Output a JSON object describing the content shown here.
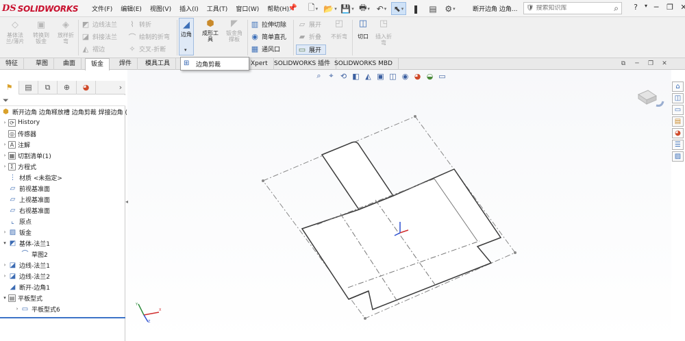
{
  "app": {
    "logo_ds": "DS",
    "logo_name": "SOLIDWORKS",
    "document_title": "断开边角 边角..."
  },
  "menu": [
    {
      "label": "文件(F)"
    },
    {
      "label": "编辑(E)"
    },
    {
      "label": "视图(V)"
    },
    {
      "label": "插入(I)"
    },
    {
      "label": "工具(T)"
    },
    {
      "label": "窗口(W)"
    },
    {
      "label": "帮助(H)"
    }
  ],
  "search": {
    "placeholder": "搜索知识库"
  },
  "ribbon": {
    "left_group": [
      {
        "label1": "基体法",
        "label2": "兰/薄片"
      },
      {
        "label1": "转换到",
        "label2": "钣金"
      },
      {
        "label1": "放样折",
        "label2": "弯"
      }
    ],
    "mid_small": [
      {
        "label": "边线法兰"
      },
      {
        "label": "斜接法兰"
      },
      {
        "label": "褶边"
      }
    ],
    "mid_small2": [
      {
        "label": "转折"
      },
      {
        "label": "绘制的折弯"
      },
      {
        "label": "交叉-折断"
      }
    ],
    "corner": {
      "label": "边角"
    },
    "forming": {
      "label1": "成形工",
      "label2": "具"
    },
    "weld_corner": {
      "label1": "钣金角",
      "label2": "撑板"
    },
    "cut_group": [
      {
        "label": "拉伸切除"
      },
      {
        "label": "简单直孔"
      },
      {
        "label": "通风口"
      }
    ],
    "unfold_group": [
      {
        "label": "展开"
      },
      {
        "label": "折叠"
      },
      {
        "label": "展开"
      }
    ],
    "no_bend": {
      "label1": "不折弯",
      "label2": ""
    },
    "cutoff": {
      "label": "切口"
    },
    "insert_bend": {
      "label1": "插入折",
      "label2": "弯"
    }
  },
  "tabs": [
    {
      "label": "特征"
    },
    {
      "label": "草图"
    },
    {
      "label": "曲面"
    },
    {
      "label": "钣金"
    },
    {
      "label": "焊件"
    },
    {
      "label": "模具工具"
    },
    {
      "label": "Xpert"
    },
    {
      "label": "SOLIDWORKS 插件"
    },
    {
      "label": "SOLIDWORKS MBD"
    }
  ],
  "dropdown": {
    "item": "边角剪裁"
  },
  "tree": {
    "root": "断开边角 边角释放槽 边角剪裁 焊接边角 (",
    "items": [
      {
        "label": "History",
        "icon": "history-icon",
        "expand": true
      },
      {
        "label": "传感器",
        "icon": "sensor-icon",
        "expand": false
      },
      {
        "label": "注解",
        "icon": "annotation-icon",
        "expand": true
      },
      {
        "label": "切割清单(1)",
        "icon": "cutlist-icon",
        "expand": true
      },
      {
        "label": "方程式",
        "icon": "equation-icon",
        "expand": true
      },
      {
        "label": "材质 <未指定>",
        "icon": "material-icon",
        "expand": false
      },
      {
        "label": "前视基准面",
        "icon": "plane-icon",
        "expand": false
      },
      {
        "label": "上视基准面",
        "icon": "plane-icon",
        "expand": false
      },
      {
        "label": "右视基准面",
        "icon": "plane-icon",
        "expand": false
      },
      {
        "label": "原点",
        "icon": "origin-icon",
        "expand": false
      },
      {
        "label": "钣金",
        "icon": "sheetmetal-icon",
        "expand": true
      },
      {
        "label": "基体-法兰1",
        "icon": "base-flange-icon",
        "expand": "open"
      },
      {
        "label": "草图2",
        "icon": "sketch-icon",
        "expand": false,
        "child": true
      },
      {
        "label": "边线-法兰1",
        "icon": "edge-flange-icon",
        "expand": true
      },
      {
        "label": "边线-法兰2",
        "icon": "edge-flange-icon",
        "expand": true
      },
      {
        "label": "断开-边角1",
        "icon": "break-corner-icon",
        "expand": false
      },
      {
        "label": "平板型式",
        "icon": "flat-pattern-icon",
        "expand": "open"
      },
      {
        "label": "平板型式6",
        "icon": "flat-pattern-sub-icon",
        "expand": true,
        "child": true
      }
    ]
  }
}
